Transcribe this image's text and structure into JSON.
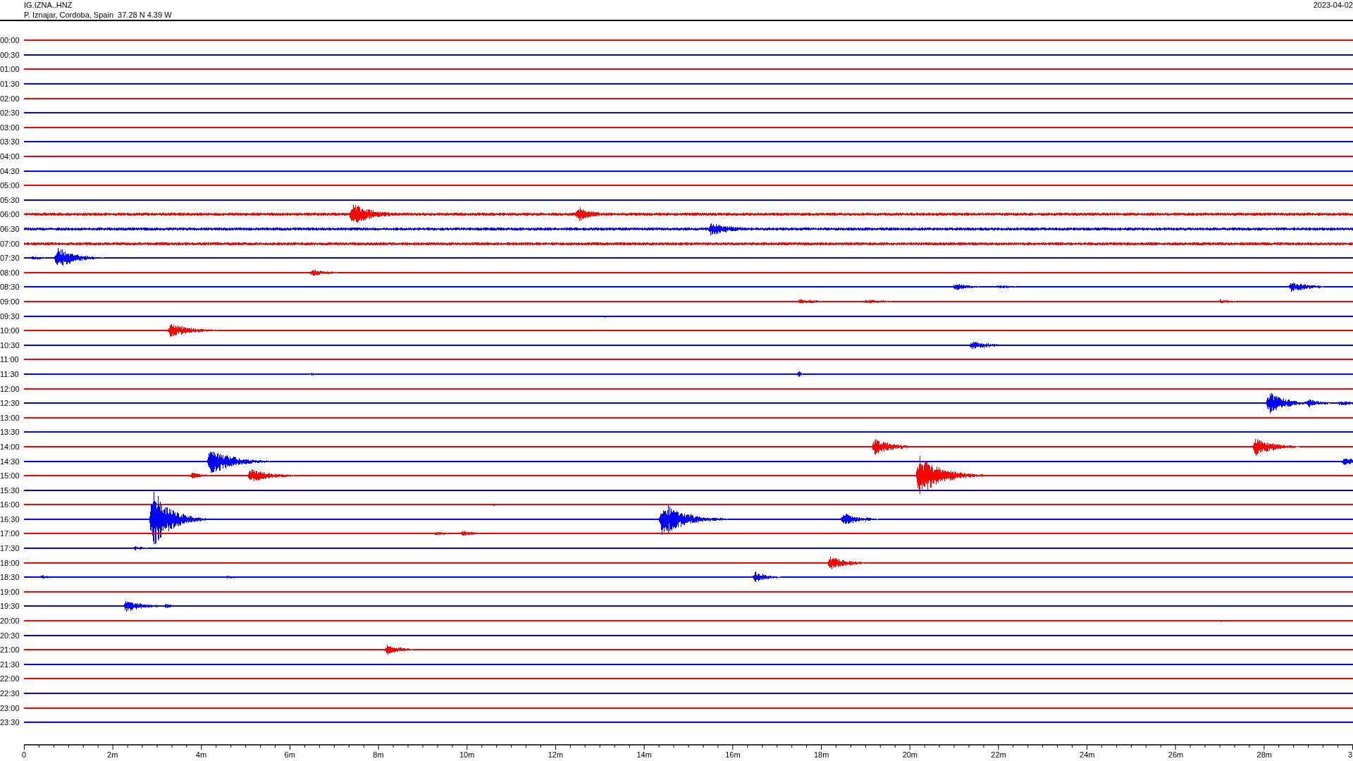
{
  "header": {
    "station": "IG.IZNA..HNZ",
    "location": "P. Iznajar, Cordoba, Spain  37.28 N 4.39 W",
    "date": "2023-04-02"
  },
  "traces": [
    {
      "time": "00:00",
      "color": "#ff0000"
    },
    {
      "time": "00:30",
      "color": "#0000ff"
    },
    {
      "time": "01:00",
      "color": "#ff0000"
    },
    {
      "time": "01:30",
      "color": "#0000ff"
    },
    {
      "time": "02:00",
      "color": "#ff0000"
    },
    {
      "time": "02:30",
      "color": "#0000ff"
    },
    {
      "time": "03:00",
      "color": "#ff0000"
    },
    {
      "time": "03:30",
      "color": "#0000ff"
    },
    {
      "time": "04:00",
      "color": "#ff0000"
    },
    {
      "time": "04:30",
      "color": "#0000ff"
    },
    {
      "time": "05:00",
      "color": "#ff0000"
    },
    {
      "time": "05:30",
      "color": "#0000ff"
    },
    {
      "time": "06:00",
      "color": "#ff0000"
    },
    {
      "time": "06:30",
      "color": "#0000ff"
    },
    {
      "time": "07:00",
      "color": "#ff0000"
    },
    {
      "time": "07:30",
      "color": "#0000ff"
    },
    {
      "time": "08:00",
      "color": "#ff0000"
    },
    {
      "time": "08:30",
      "color": "#0000ff"
    },
    {
      "time": "09:00",
      "color": "#ff0000"
    },
    {
      "time": "09:30",
      "color": "#0000ff"
    },
    {
      "time": "10:00",
      "color": "#ff0000"
    },
    {
      "time": "10:30",
      "color": "#0000ff"
    },
    {
      "time": "11:00",
      "color": "#ff0000"
    },
    {
      "time": "11:30",
      "color": "#0000ff"
    },
    {
      "time": "12:00",
      "color": "#ff0000"
    },
    {
      "time": "12:30",
      "color": "#0000ff"
    },
    {
      "time": "13:00",
      "color": "#ff0000"
    },
    {
      "time": "13:30",
      "color": "#0000ff"
    },
    {
      "time": "14:00",
      "color": "#ff0000"
    },
    {
      "time": "14:30",
      "color": "#0000ff"
    },
    {
      "time": "15:00",
      "color": "#ff0000"
    },
    {
      "time": "15:30",
      "color": "#0000ff"
    },
    {
      "time": "16:00",
      "color": "#ff0000"
    },
    {
      "time": "16:30",
      "color": "#0000ff"
    },
    {
      "time": "17:00",
      "color": "#ff0000"
    },
    {
      "time": "17:30",
      "color": "#0000ff"
    },
    {
      "time": "18:00",
      "color": "#ff0000"
    },
    {
      "time": "18:30",
      "color": "#0000ff"
    },
    {
      "time": "19:00",
      "color": "#ff0000"
    },
    {
      "time": "19:30",
      "color": "#0000ff"
    },
    {
      "time": "20:00",
      "color": "#ff0000"
    },
    {
      "time": "20:30",
      "color": "#0000ff"
    },
    {
      "time": "21:00",
      "color": "#ff0000"
    },
    {
      "time": "21:30",
      "color": "#0000ff"
    },
    {
      "time": "22:00",
      "color": "#ff0000"
    },
    {
      "time": "22:30",
      "color": "#0000ff"
    },
    {
      "time": "23:00",
      "color": "#ff0000"
    },
    {
      "time": "23:30",
      "color": "#0000ff"
    }
  ],
  "x_axis": {
    "ticks": [
      "0",
      "2m",
      "4m",
      "6m",
      "8m",
      "10m",
      "12m",
      "14m",
      "16m",
      "18m",
      "20m",
      "22m",
      "24m",
      "26m",
      "28m",
      "3"
    ]
  }
}
